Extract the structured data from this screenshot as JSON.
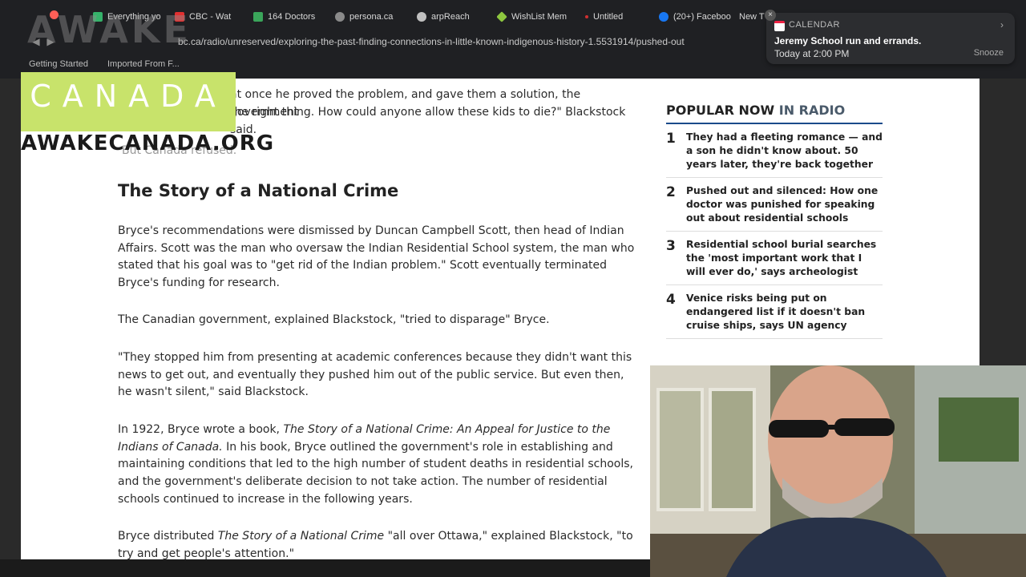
{
  "browser": {
    "tabs": [
      {
        "label": "Everything yo",
        "color": "#35b26a"
      },
      {
        "label": "CBC - Wat",
        "color": "#e03030"
      },
      {
        "label": "164 Doctors",
        "color": "#3aa55a"
      },
      {
        "label": "persona.ca",
        "color": "#8a8a8a"
      },
      {
        "label": "arpReach",
        "color": "#c0c0c0"
      },
      {
        "label": "WishList Mem",
        "color": "#8dc63f"
      },
      {
        "label": "Untitled",
        "color": "#d03030"
      },
      {
        "label": "(20+) Faceboo",
        "color": "#1877f2"
      },
      {
        "label": "New T",
        "color": "#888888"
      }
    ],
    "url": "bc.ca/radio/unreserved/exploring-the-past-finding-connections-in-little-known-indigenous-history-1.5531914/pushed-out",
    "bookmarks": [
      "Getting Started",
      "Imported From F..."
    ]
  },
  "logo": {
    "top_text": "AWAKE",
    "band_text": "CANADA",
    "bottom_text": "AWAKECANADA.ORG",
    "band_color": "#c8e36b"
  },
  "article": {
    "p1": "at once he proved the problem, and gave them a solution, the government",
    "p1b": "the right thing. How could anyone allow these kids to die?\" Blackstock said.",
    "p_short": "But Canada refused.",
    "heading": "The Story of a National Crime",
    "p2": "Bryce's recommendations were dismissed by Duncan Campbell Scott, then head of Indian Affairs. Scott was the man who oversaw the Indian Residential School system, the man who stated that his goal was to \"get rid of the Indian problem.\" Scott eventually terminated Bryce's funding for research.",
    "p3": "The Canadian government, explained Blackstock, \"tried to disparage\" Bryce.",
    "p4": "\"They stopped him from presenting at academic conferences because they didn't want this news to get out, and eventually they pushed him out of the public service. But even then, he wasn't silent,\" said Blackstock.",
    "p5_pre": "In 1922, Bryce wrote a book, ",
    "p5_em": "The Story of a National Crime: An Appeal for Justice to the Indians of Canada.",
    "p5_post": " In his book, Bryce outlined the government's role in establishing and maintaining conditions that led to the high number of student deaths in residential schools, and the government's deliberate decision to not take action. The number of residential schools continued to increase in the following years.",
    "p6_pre": "Bryce distributed ",
    "p6_em": "The Story of a National Crime",
    "p6_post": " \"all over Ottawa,\" explained Blackstock, \"to try and get people's attention.\""
  },
  "popular": {
    "title": "POPULAR NOW",
    "title_accent": "IN RADIO",
    "items": [
      {
        "num": "1",
        "text": "They had a fleeting romance — and a son he didn't know about. 50 years later, they're back together"
      },
      {
        "num": "2",
        "text": "Pushed out and silenced: How one doctor was punished for speaking out about residential schools"
      },
      {
        "num": "3",
        "text": "Residential school burial searches the 'most important work that I will ever do,' says archeologist"
      },
      {
        "num": "4",
        "text": "Venice risks being put on endangered list if it doesn't ban cruise ships, says UN agency"
      }
    ]
  },
  "notification": {
    "app": "CALENDAR",
    "title": "Jeremy School run and errands.",
    "time": "Today at 2:00 PM",
    "snooze": "Snooze"
  }
}
